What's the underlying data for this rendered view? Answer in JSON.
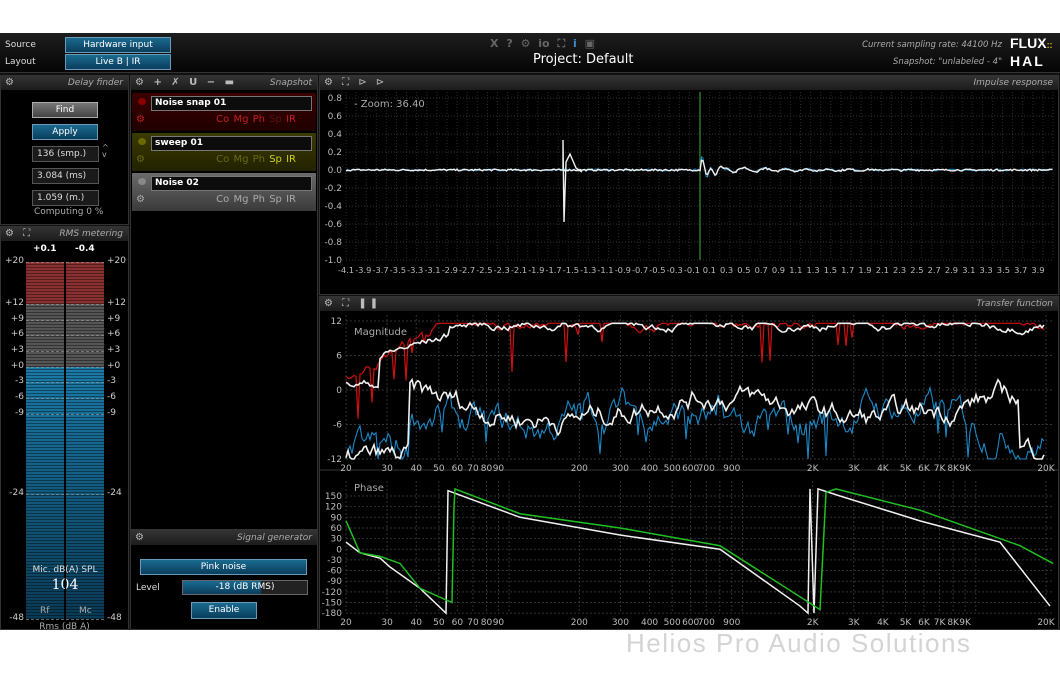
{
  "header": {
    "source_label": "Source",
    "source_value": "Hardware input",
    "layout_label": "Layout",
    "layout_value": "Live B | IR",
    "toolbar_icons": [
      "close-icon",
      "help-icon",
      "settings-icon",
      "io-icon",
      "fullscreen-icon",
      "info-icon",
      "text-icon"
    ],
    "toolbar_glyphs": [
      "X",
      "?",
      "⚙",
      "io",
      "⛶",
      "i",
      "▣"
    ],
    "project_title": "Project: Default",
    "sampling_rate": "Current sampling rate: 44100 Hz",
    "snapshot_status": "Snapshot: \"unlabeled - 4\"",
    "logo_top": "FLUX::",
    "logo_bottom": "HAL"
  },
  "delay_finder": {
    "title": "Delay finder",
    "find": "Find",
    "apply": "Apply",
    "samples": "136 (smp.)",
    "ms": "3.084 (ms)",
    "meters": "1.059 (m.)",
    "status": "Computing 0 %"
  },
  "snapshot": {
    "title": "Snapshot",
    "items": [
      {
        "name": "Noise snap 01",
        "tags": [
          "Co",
          "Mg",
          "Ph",
          "Sp",
          "IR"
        ],
        "color": "#8a0000"
      },
      {
        "name": "sweep 01",
        "tags": [
          "Co",
          "Mg",
          "Ph",
          "Sp",
          "IR"
        ],
        "color": "#6a6a00"
      },
      {
        "name": "Noise 02",
        "tags": [
          "Co",
          "Mg",
          "Ph",
          "Sp",
          "IR"
        ],
        "color": "#888888"
      }
    ]
  },
  "rms": {
    "title": "RMS metering",
    "peak_left": "+0.1",
    "peak_right": "-0.4",
    "scale": [
      "+20",
      "+12",
      "+9",
      "+6",
      "+3",
      "+0",
      "-3",
      "-6",
      "-9",
      "-24",
      "-48"
    ],
    "spl_label": "Mic. dB(A) SPL",
    "spl_value": "104",
    "ch_left": "Rf",
    "ch_right": "Mc",
    "unit": "Rms (dB A)",
    "level_left_db": 0.1,
    "level_right_db": -0.4
  },
  "signal_generator": {
    "title": "Signal generator",
    "type": "Pink noise",
    "level_label": "Level",
    "level_value": "-18 (dB RMS)",
    "level_fraction": 0.63,
    "enable": "Enable"
  },
  "impulse": {
    "title": "Impulse response",
    "zoom": "- Zoom: 36.40",
    "y_ticks": [
      "0.8",
      "0.6",
      "0.4",
      "0.2",
      "0.0",
      "-0.2",
      "-0.4",
      "-0.6",
      "-0.8",
      "-1.0"
    ],
    "x_ticks": [
      "-4.1",
      "-3.9",
      "-3.7",
      "-3.5",
      "-3.3",
      "-3.1",
      "-2.9",
      "-2.7",
      "-2.5",
      "-2.3",
      "-2.1",
      "-1.9",
      "-1.7",
      "-1.5",
      "-1.3",
      "-1.1",
      "-0.9",
      "-0.7",
      "-0.5",
      "-0.3",
      "-0.1",
      "0.1",
      "0.3",
      "0.5",
      "0.7",
      "0.9",
      "1.1",
      "1.3",
      "1.5",
      "1.7",
      "1.9",
      "2.1",
      "2.3",
      "2.5",
      "2.7",
      "2.9",
      "3.1",
      "3.3",
      "3.5",
      "3.7",
      "3.9"
    ]
  },
  "transfer": {
    "title": "Transfer function",
    "magnitude_label": "Magnitude",
    "phase_label": "Phase",
    "mag_ticks": [
      "12",
      "6",
      "0",
      "-6",
      "-12"
    ],
    "phase_ticks": [
      "150",
      "120",
      "90",
      "60",
      "30",
      "0",
      "-30",
      "-60",
      "-90",
      "-120",
      "-150",
      "-180"
    ],
    "freq_ticks": [
      "20",
      "30",
      "40",
      "50",
      "60",
      "70",
      "80",
      "90",
      "200",
      "300",
      "400",
      "500",
      "600",
      "700",
      "900",
      "2K",
      "3K",
      "4K",
      "5K",
      "6K",
      "7K",
      "8K",
      "9K",
      "20K"
    ],
    "colors": {
      "red": "#d01010",
      "blue": "#1a8ac8",
      "white": "#f0f0f0",
      "green": "#20c020"
    }
  },
  "footer": {
    "watermark": "Helios Pro Audio Solutions"
  }
}
